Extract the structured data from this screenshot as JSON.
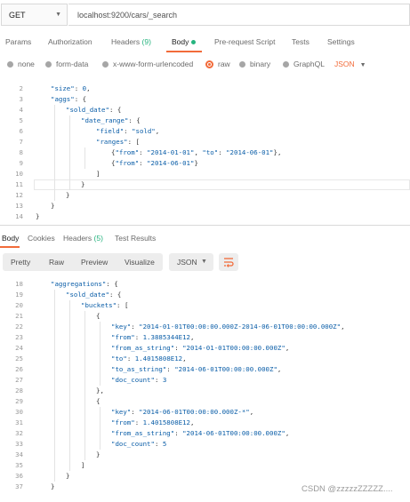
{
  "request": {
    "method": "GET",
    "url": "localhost:9200/cars/_search"
  },
  "tabs": [
    {
      "label": "Params"
    },
    {
      "label": "Authorization"
    },
    {
      "label": "Headers",
      "count": "(9)"
    },
    {
      "label": "Body"
    },
    {
      "label": "Pre-request Script"
    },
    {
      "label": "Tests"
    },
    {
      "label": "Settings"
    }
  ],
  "body_types": {
    "options": [
      "none",
      "form-data",
      "x-www-form-urlencoded",
      "raw",
      "binary",
      "GraphQL"
    ],
    "selected": "raw",
    "format": "JSON"
  },
  "request_body": [
    {
      "n": "2",
      "t": "\"size\": 0,"
    },
    {
      "n": "3",
      "t": "\"aggs\": {"
    },
    {
      "n": "4",
      "t": "\"sold_date\": {"
    },
    {
      "n": "5",
      "t": "\"date_range\": {"
    },
    {
      "n": "6",
      "t": "\"field\": \"sold\","
    },
    {
      "n": "7",
      "t": "\"ranges\": ["
    },
    {
      "n": "8",
      "t": "{\"from\": \"2014-01-01\", \"to\": \"2014-06-01\"},"
    },
    {
      "n": "9",
      "t": "{\"from\": \"2014-06-01\"}"
    },
    {
      "n": "10",
      "t": "]"
    },
    {
      "n": "11",
      "t": "}"
    },
    {
      "n": "12",
      "t": "}"
    },
    {
      "n": "13",
      "t": "}"
    },
    {
      "n": "14",
      "t": "}"
    }
  ],
  "response_tabs": [
    {
      "label": "Body"
    },
    {
      "label": "Cookies"
    },
    {
      "label": "Headers",
      "count": "(5)"
    },
    {
      "label": "Test Results"
    }
  ],
  "response_toolbar": {
    "views": [
      "Pretty",
      "Raw",
      "Preview",
      "Visualize"
    ],
    "format": "JSON"
  },
  "response_body": [
    {
      "n": "18",
      "t": "\"aggregations\": {"
    },
    {
      "n": "19",
      "t": "\"sold_date\": {"
    },
    {
      "n": "20",
      "t": "\"buckets\": ["
    },
    {
      "n": "21",
      "t": "{"
    },
    {
      "n": "22",
      "t": "\"key\": \"2014-01-01T00:00:00.000Z-2014-06-01T00:00:00.000Z\","
    },
    {
      "n": "23",
      "t": "\"from\": 1.3885344E12,"
    },
    {
      "n": "24",
      "t": "\"from_as_string\": \"2014-01-01T00:00:00.000Z\","
    },
    {
      "n": "25",
      "t": "\"to\": 1.4015808E12,"
    },
    {
      "n": "26",
      "t": "\"to_as_string\": \"2014-06-01T00:00:00.000Z\","
    },
    {
      "n": "27",
      "t": "\"doc_count\": 3"
    },
    {
      "n": "28",
      "t": "},"
    },
    {
      "n": "29",
      "t": "{"
    },
    {
      "n": "30",
      "t": "\"key\": \"2014-06-01T00:00:00.000Z-*\","
    },
    {
      "n": "31",
      "t": "\"from\": 1.4015808E12,"
    },
    {
      "n": "32",
      "t": "\"from_as_string\": \"2014-06-01T00:00:00.000Z\","
    },
    {
      "n": "33",
      "t": "\"doc_count\": 5"
    },
    {
      "n": "34",
      "t": "}"
    },
    {
      "n": "35",
      "t": "]"
    },
    {
      "n": "36",
      "t": "}"
    },
    {
      "n": "37",
      "t": "}"
    }
  ],
  "watermark": "CSDN @zzzzzZZZZZ...."
}
